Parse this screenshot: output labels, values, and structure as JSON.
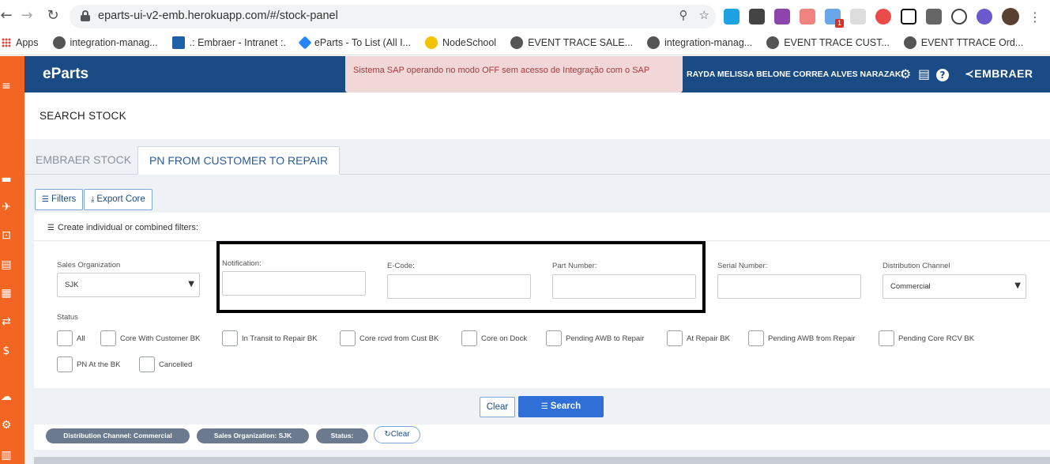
{
  "browser": {
    "url": "eparts-ui-v2-emb.herokuapp.com/#/stock-panel",
    "bookmarks": [
      {
        "label": "Apps"
      },
      {
        "label": "integration-manag..."
      },
      {
        "label": ".: Embraer - Intranet :."
      },
      {
        "label": "eParts - To List (All I..."
      },
      {
        "label": "NodeSchool"
      },
      {
        "label": "EVENT TRACE SALE..."
      },
      {
        "label": "integration-manag..."
      },
      {
        "label": "EVENT TRACE CUST..."
      },
      {
        "label": "EVENT TTRACE Ord..."
      }
    ]
  },
  "header": {
    "brand": "eParts",
    "sap_alert": "Sistema SAP operando no modo OFF sem acesso de Integração com o SAP",
    "user_name": "RAYDA MELISSA BELONE CORREA ALVES NARAZAKI",
    "logo_text": "EMBRAER"
  },
  "page": {
    "title": "SEARCH STOCK",
    "tabs": [
      {
        "label": "EMBRAER STOCK",
        "active": false
      },
      {
        "label": "PN FROM CUSTOMER TO REPAIR",
        "active": true
      }
    ],
    "filters_button": "Filters",
    "export_button": "Export Core",
    "filter_hint": "Create individual or combined filters:"
  },
  "form": {
    "sales_org": {
      "label": "Sales Organization",
      "value": "SJK"
    },
    "notification": {
      "label": "Notification:",
      "value": ""
    },
    "ecode": {
      "label": "E-Code:",
      "value": ""
    },
    "part_number": {
      "label": "Part Number:",
      "value": ""
    },
    "serial_number": {
      "label": "Serial Number:",
      "value": ""
    },
    "distribution_channel": {
      "label": "Distribution Channel",
      "value": "Commercial"
    },
    "status_label": "Status",
    "statuses": [
      {
        "label": "All",
        "checked": false
      },
      {
        "label": "Core With Customer BK",
        "checked": false
      },
      {
        "label": "In Transit to Repair BK",
        "checked": false
      },
      {
        "label": "Core rcvd from Cust BK",
        "checked": false
      },
      {
        "label": "Core on Dock",
        "checked": false
      },
      {
        "label": "Pending AWB to Repair",
        "checked": false
      },
      {
        "label": "At Repair BK",
        "checked": false
      },
      {
        "label": "Pending AWB from Repair",
        "checked": false
      },
      {
        "label": "Pending Core RCV BK",
        "checked": false
      },
      {
        "label": "PN At the BK",
        "checked": false
      },
      {
        "label": "Cancelled",
        "checked": false
      }
    ]
  },
  "actions": {
    "clear": "Clear",
    "search": "Search"
  },
  "chips": {
    "distribution": "Distribution Channel: Commercial",
    "sales_org": "Sales Organization: SJK",
    "status": "Status:",
    "clear": "Clear"
  },
  "colors": {
    "header_bg": "#1a4b85",
    "sidebar_bg": "#f26522",
    "alert_bg": "#f2d7d9",
    "primary_btn": "#2f6fd6"
  }
}
